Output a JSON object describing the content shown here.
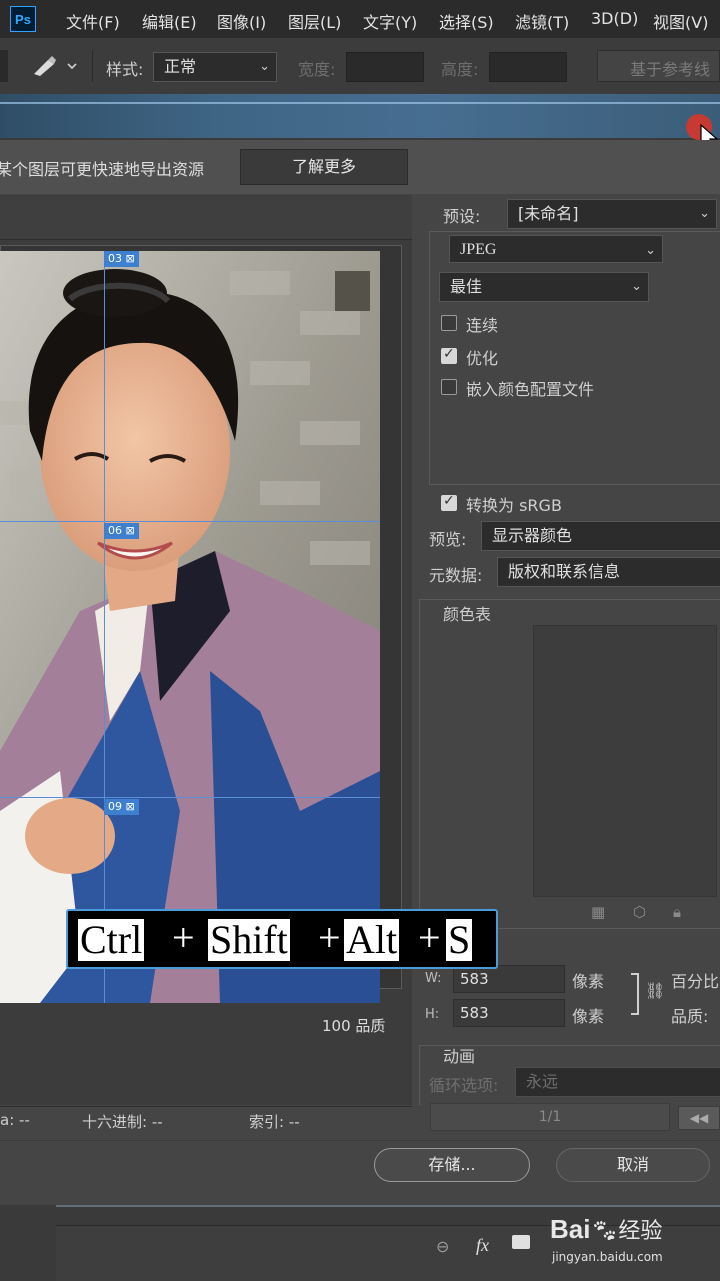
{
  "app": {
    "logo": "Ps"
  },
  "menu": [
    "文件(F)",
    "编辑(E)",
    "图像(I)",
    "图层(L)",
    "文字(Y)",
    "选择(S)",
    "滤镜(T)",
    "3D(D)",
    "视图(V)"
  ],
  "options": {
    "style_label": "样式:",
    "style_value": "正常",
    "width_label": "宽度:",
    "height_label": "高度:",
    "refine_label": "基于参考线"
  },
  "notice": {
    "text": "某个图层可更快速地导出资源",
    "learn_more": "了解更多"
  },
  "slices": [
    "03",
    "06",
    "09"
  ],
  "preview": {
    "quality_value": "100",
    "quality_label": "品质"
  },
  "status": {
    "alpha_label": "a:",
    "alpha_value": "--",
    "hex_label": "十六进制:",
    "hex_value": "--",
    "index_label": "索引:",
    "index_value": "--"
  },
  "settings": {
    "preset_label": "预设:",
    "preset_value": "[未命名]",
    "format": "JPEG",
    "quality_preset": "最佳",
    "progressive_label": "连续",
    "progressive_checked": false,
    "optimized_label": "优化",
    "optimized_checked": true,
    "embed_profile_label": "嵌入颜色配置文件",
    "embed_profile_checked": false,
    "convert_srgb_label": "转换为 sRGB",
    "convert_srgb_checked": true,
    "preview_label": "预览:",
    "preview_value": "显示器颜色",
    "metadata_label": "元数据:",
    "metadata_value": "版权和联系信息",
    "color_table_label": "颜色表"
  },
  "image_size": {
    "width_prefix": "W:",
    "width_value": "583",
    "width_unit": "像素",
    "height_prefix": "H:",
    "height_value": "583",
    "height_unit": "像素",
    "percent_label": "百分比",
    "quality_label": "品质:"
  },
  "animation": {
    "title": "动画",
    "loop_label": "循环选项:",
    "loop_value": "永远",
    "frame_counter": "1/1"
  },
  "buttons": {
    "save": "存储...",
    "cancel": "取消"
  },
  "shortcut_overlay": {
    "keys": [
      "Ctrl",
      "Shift",
      "Alt",
      "S"
    ],
    "separator": "+"
  },
  "watermark": {
    "brand": "Bai",
    "brand2": "经验",
    "url": "jingyan.baidu.com"
  },
  "colors": {
    "accent": "#4a9bd8",
    "menubar": "#2b2b2b",
    "panel": "#454545"
  }
}
